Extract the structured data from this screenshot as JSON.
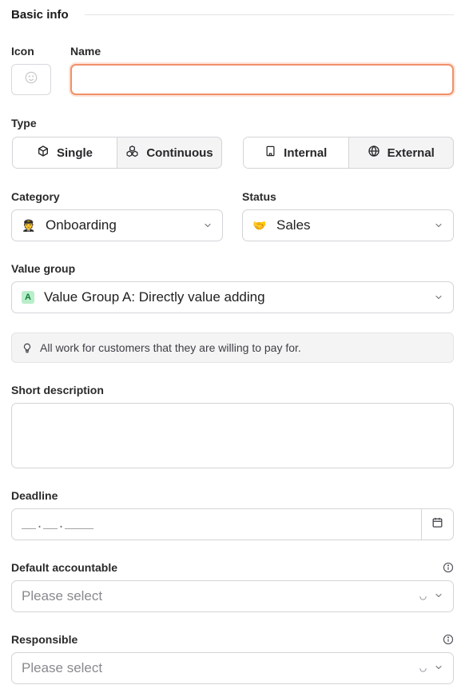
{
  "section": {
    "title": "Basic info"
  },
  "fields": {
    "icon_label": "Icon",
    "name_label": "Name",
    "name_value": "",
    "type_label": "Type",
    "category_label": "Category",
    "status_label": "Status",
    "value_group_label": "Value group",
    "short_description_label": "Short description",
    "short_description_value": "",
    "deadline_label": "Deadline",
    "deadline_placeholder": "__.__.____",
    "default_accountable_label": "Default accountable",
    "responsible_label": "Responsible"
  },
  "type_toggle": {
    "options": [
      {
        "label": "Single",
        "icon": "cube-icon",
        "selected": true
      },
      {
        "label": "Continuous",
        "icon": "cubes-icon",
        "selected": false
      }
    ]
  },
  "scope_toggle": {
    "options": [
      {
        "label": "Internal",
        "icon": "building-icon",
        "selected": true
      },
      {
        "label": "External",
        "icon": "globe-icon",
        "selected": false
      }
    ]
  },
  "category": {
    "value": "Onboarding",
    "emoji": "🧑‍✈️"
  },
  "status": {
    "value": "Sales",
    "emoji": "🤝"
  },
  "value_group": {
    "badge": "A",
    "value": "Value Group A: Directly value adding",
    "badge_color": "#b8eec9"
  },
  "hint": {
    "text": "All work for customers that they are willing to pay for.",
    "icon": "lightbulb-icon"
  },
  "default_accountable": {
    "placeholder": "Please select"
  },
  "responsible": {
    "placeholder": "Please select"
  },
  "colors": {
    "focus_border": "#f0906a",
    "segment_bg": "#f4f4f5",
    "border": "#d4d4d8"
  }
}
